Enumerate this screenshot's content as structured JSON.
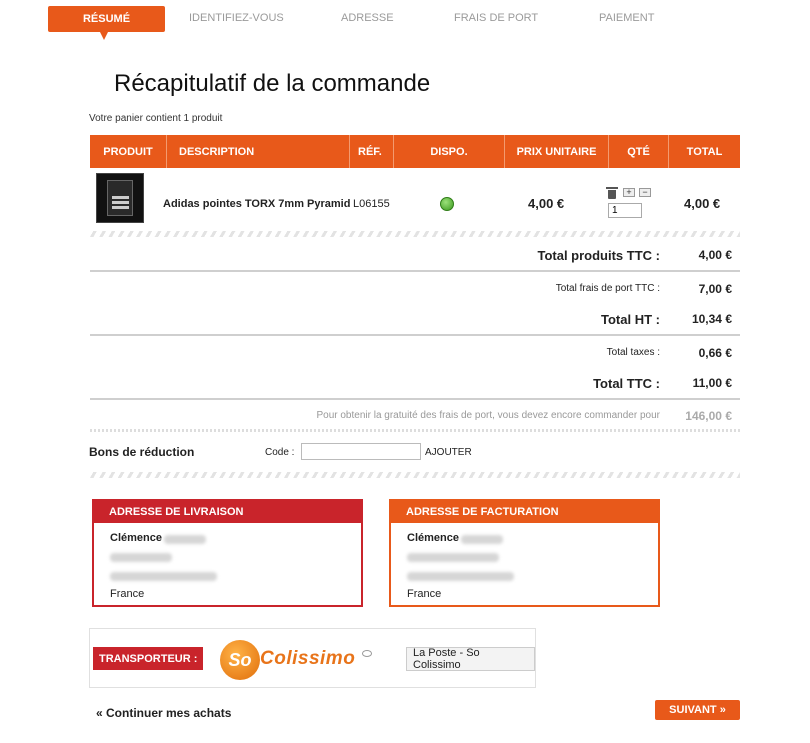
{
  "steps": [
    "Résumé",
    "Identifiez-vous",
    "Adresse",
    "Frais de port",
    "Paiement"
  ],
  "title": "Récapitulatif de la commande",
  "cart_count": "Votre panier contient 1 produit",
  "table": {
    "headers": [
      "PRODUIT",
      "DESCRIPTION",
      "RÉF.",
      "DISPO.",
      "PRIX UNITAIRE",
      "QTÉ",
      "TOTAL"
    ],
    "row": {
      "description": "Adidas pointes TORX 7mm Pyramid",
      "ref": "L06155",
      "dispo": "in-stock-icon",
      "unit_price": "4,00 €",
      "qty": "1",
      "plus": "+",
      "minus": "−",
      "total": "4,00 €"
    }
  },
  "summary": {
    "total_produits_label": "Total produits TTC :",
    "total_produits": "4,00 €",
    "frais_port_label": "Total frais de port TTC :",
    "frais_port": "7,00 €",
    "total_ht_label": "Total HT :",
    "total_ht": "10,34 €",
    "taxes_label": "Total taxes :",
    "taxes": "0,66 €",
    "total_ttc_label": "Total TTC :",
    "total_ttc": "11,00 €",
    "free_shipping_label": "Pour obtenir la gratuité des frais de port, vous devez encore commander pour",
    "free_shipping": "146,00 €"
  },
  "voucher": {
    "label": "Bons de réduction",
    "code_label": "Code :",
    "code_value": "",
    "add": "AJOUTER"
  },
  "delivery": {
    "title": "ADRESSE DE LIVRAISON",
    "name": "Clémence",
    "country": "France",
    "color": "#c9242b"
  },
  "billing": {
    "title": "ADRESSE DE FACTURATION",
    "name": "Clémence",
    "country": "France",
    "color": "#e8591a"
  },
  "carrier": {
    "label": "TRANSPORTEUR :",
    "logo_so": "So",
    "logo_text": "Colissimo",
    "name": "La Poste - So Colissimo"
  },
  "continue": "« Continuer mes achats",
  "next": "SUIVANT »"
}
